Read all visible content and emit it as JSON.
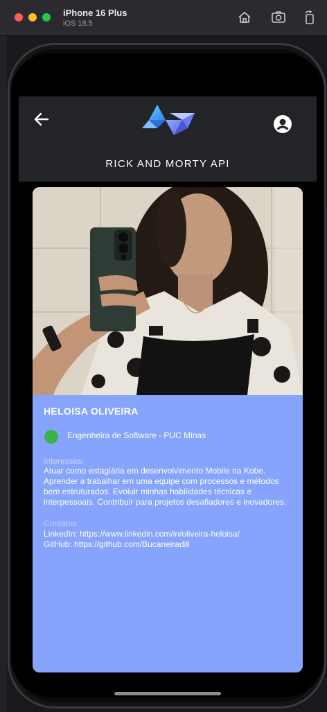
{
  "simulator": {
    "device_name": "iPhone 16 Plus",
    "os_version": "iOS 18.5"
  },
  "app": {
    "title": "RICK AND MORTY API",
    "logo_colors": [
      "#3aa0f0",
      "#6a7cf2",
      "#8aa5f8"
    ]
  },
  "icons": {
    "back": "arrow-left-icon",
    "profile": "account-circle-icon",
    "home": "home-icon",
    "screenshot": "camera-icon",
    "rotate": "rotate-icon"
  },
  "profile": {
    "name": "HELOISA OLIVEIRA",
    "status_color": "#3eb24a",
    "role": "Engenheira de Software - PUC Minas",
    "interests_label": "Interesses:",
    "interests_lines": [
      "Atuar como estagiária em desenvolvimento Mobile na Kobe.",
      "Aprender a trabalhar em uma equipe com processos e métodos",
      "bem estruturados. Evoluir minhas habilidades técnicas e",
      "interpessoais. Contribuir para projetos desafiadores e inovadores."
    ],
    "contacts_label": "Contatos:",
    "linkedin": "LinkedIn: https://www.linkedin.com/in/oliveira-heloisa/",
    "github": "GitHub: https://github.com/Bucaneiradill"
  },
  "colors": {
    "card_background": "#86a4fb",
    "header_background": "#232428"
  }
}
